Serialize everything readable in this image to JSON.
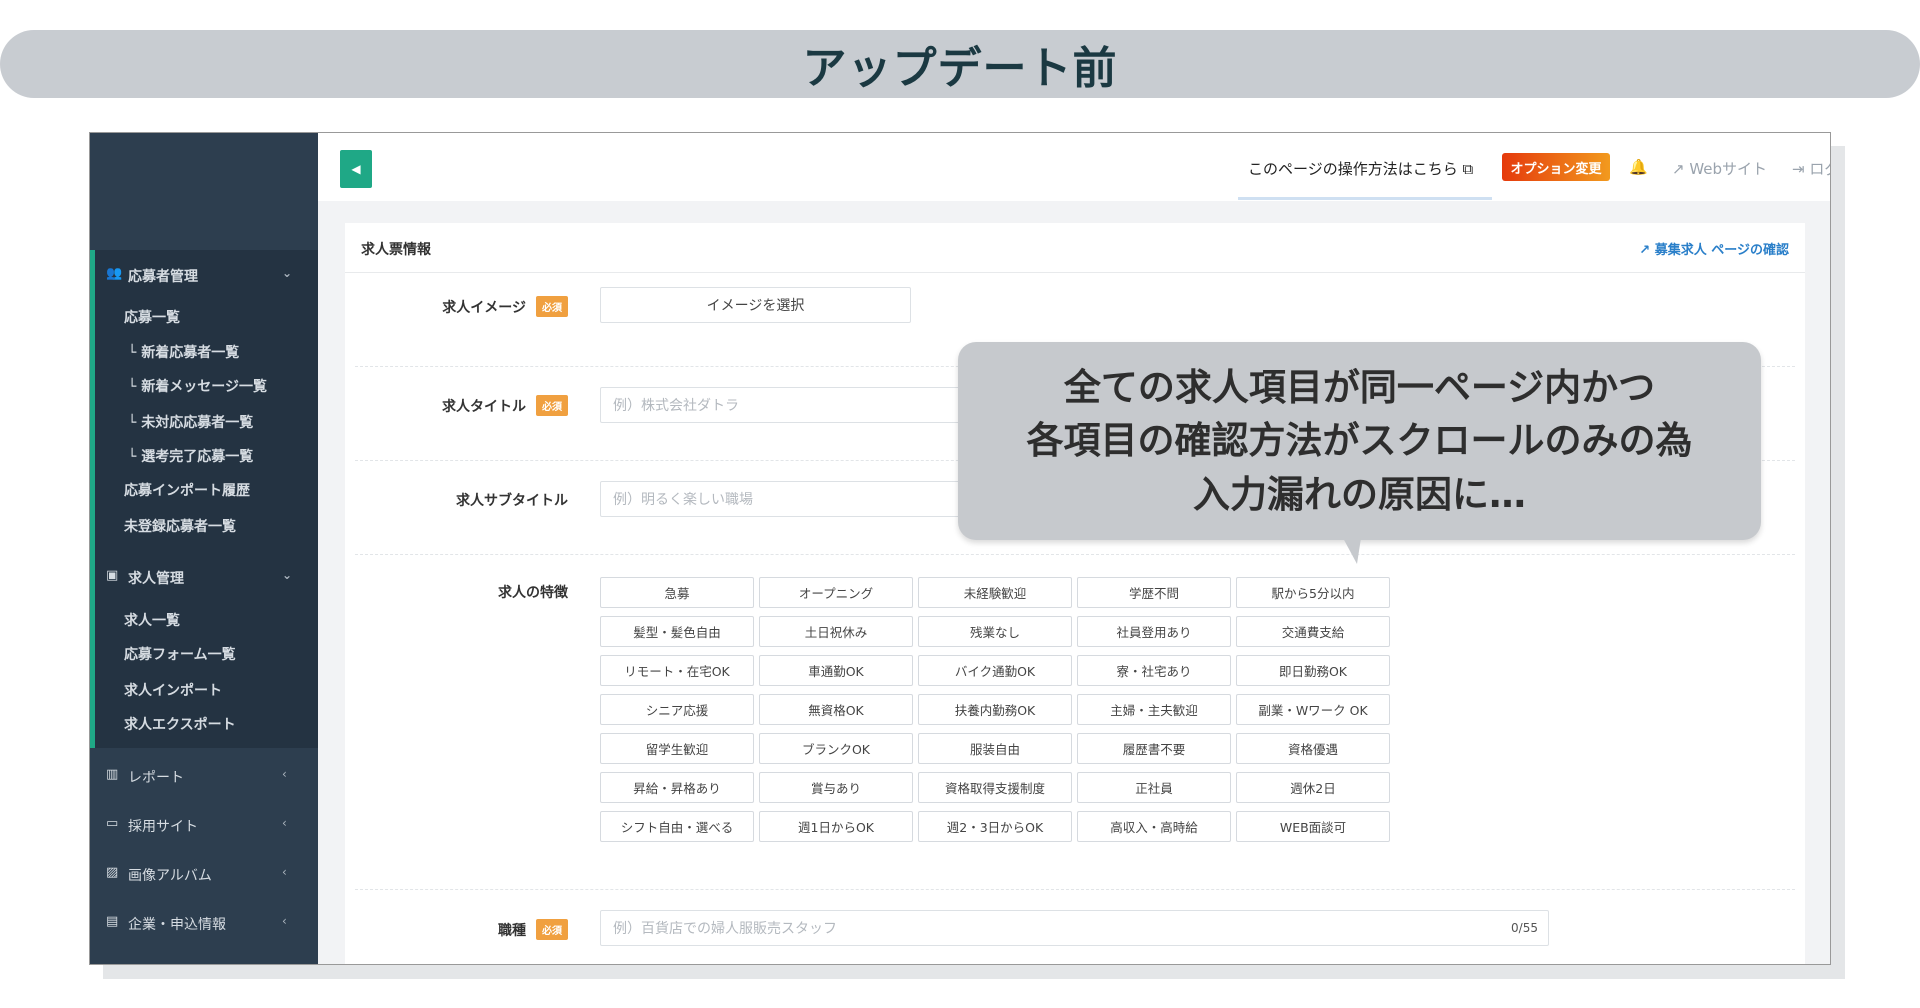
{
  "banner": {
    "title": "アップデート前"
  },
  "sidebar": {
    "groups": [
      {
        "label": "応募者管理",
        "icon": "users-icon",
        "items": [
          "応募一覧",
          "└ 新着応募者一覧",
          "└ 新着メッセージ一覧",
          "└ 未対応応募者一覧",
          "└ 選考完了応募一覧",
          "応募インポート履歴",
          "未登録応募者一覧"
        ]
      },
      {
        "label": "求人管理",
        "icon": "id-card-icon",
        "items": [
          "求人一覧",
          "応募フォーム一覧",
          "求人インポート",
          "求人エクスポート"
        ]
      }
    ],
    "collapsed": [
      {
        "label": "レポート",
        "icon": "bar-chart-icon"
      },
      {
        "label": "採用サイト",
        "icon": "laptop-icon"
      },
      {
        "label": "画像アルバム",
        "icon": "image-icon"
      },
      {
        "label": "企業・申込情報",
        "icon": "building-icon"
      }
    ]
  },
  "header": {
    "help": "このページの操作方法はこちら",
    "option": "オプション変更",
    "website": "Webサイト",
    "logout": "ログアウト"
  },
  "card": {
    "title": "求人票情報",
    "link": "募集求人 ページの確認",
    "required": "必須",
    "image_label": "求人イメージ",
    "image_button": "イメージを選択",
    "title_label": "求人タイトル",
    "title_placeholder": "例）株式会社ダトラ",
    "subtitle_label": "求人サブタイトル",
    "subtitle_placeholder": "例）明るく楽しい職場",
    "features_label": "求人の特徴",
    "features": [
      "急募",
      "オープニング",
      "未経験歓迎",
      "学歴不問",
      "駅から5分以内",
      "髪型・髪色自由",
      "土日祝休み",
      "残業なし",
      "社員登用あり",
      "交通費支給",
      "リモート・在宅OK",
      "車通勤OK",
      "バイク通勤OK",
      "寮・社宅あり",
      "即日勤務OK",
      "シニア応援",
      "無資格OK",
      "扶養内勤務OK",
      "主婦・主夫歓迎",
      "副業・Wワーク OK",
      "留学生歓迎",
      "ブランクOK",
      "服装自由",
      "履歴書不要",
      "資格優遇",
      "昇給・昇格あり",
      "賞与あり",
      "資格取得支援制度",
      "正社員",
      "週休2日",
      "シフト自由・選べる",
      "週1日からOK",
      "週2・3日からOK",
      "高収入・高時給",
      "WEB面談可"
    ],
    "job_label": "職種",
    "job_placeholder": "例）百貨店での婦人服販売スタッフ",
    "job_count": "0/55"
  },
  "callout": {
    "lines": [
      "全ての求人項目が同一ページ内かつ",
      "各項目の確認方法がスクロールのみの為",
      "入力漏れの原因に…"
    ]
  }
}
